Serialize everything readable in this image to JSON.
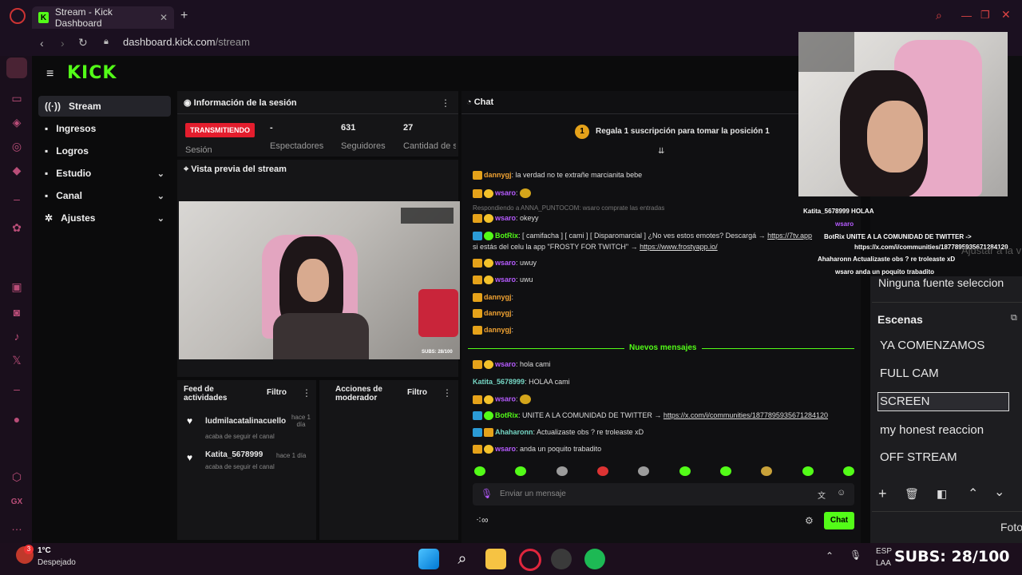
{
  "browser": {
    "tab_title": "Stream - Kick Dashboard",
    "new_tab": "+",
    "url_host": "dashboard.kick.com",
    "url_path": "/stream"
  },
  "dashboard": {
    "logo": "KICK",
    "nav": [
      {
        "label": "Stream",
        "icon": "broadcast-icon"
      },
      {
        "label": "Ingresos",
        "icon": "money-icon"
      },
      {
        "label": "Logros",
        "icon": "trophy-icon"
      },
      {
        "label": "Estudio",
        "icon": "studio-icon"
      },
      {
        "label": "Canal",
        "icon": "channel-icon"
      },
      {
        "label": "Ajustes",
        "icon": "gear-icon"
      }
    ],
    "session": {
      "title": "Información de la sesión",
      "status_pill": "TRANSMITIENDO",
      "status_label": "Sesión",
      "viewers_value": "-",
      "viewers_label": "Espectadores",
      "followers_value": "631",
      "followers_label": "Seguidores",
      "subs_value": "27",
      "subs_label": "Cantidad de suscripciones"
    },
    "preview": {
      "title": "Vista previa del stream",
      "overlay_subs": "SUBS: 28/100"
    },
    "activity": {
      "title": "Feed de actividades",
      "filter": "Filtro",
      "items": [
        {
          "user": "ludmilacatalinacuello",
          "action": "acaba de seguir el canal",
          "time": "hace 1 día"
        },
        {
          "user": "Katita_5678999",
          "action": "acaba de seguir el canal",
          "time": "hace 1 día"
        }
      ]
    },
    "mod": {
      "title": "Acciones de moderador",
      "filter": "Filtro"
    },
    "chat": {
      "title": "Chat",
      "pinned_badge": "1",
      "pinned_text": "Regala 1 suscripción para tomar la posición 1",
      "reply_note": "Respondiendo a ANNA_PUNTOCOM: wsaro comprate las entradas",
      "new_messages": "Nuevos mensajes",
      "messages_top": [
        {
          "user": "dannygj",
          "text": ": la verdad no te extrañe marcianita bebe"
        },
        {
          "user": "wsaro",
          "text": ":"
        },
        {
          "user": "wsaro",
          "text": ": okeyy"
        },
        {
          "user": "BotRix",
          "text": ": [ camifacha ] [ cami ] [ Disparomarcial ] ¿No ves estos emotes? Descargá → "
        },
        {
          "user": "",
          "text": "si estás del celu la app \"FROSTY FOR TWITCH\" → "
        },
        {
          "user": "wsaro",
          "text": ": uwuy"
        },
        {
          "user": "wsaro",
          "text": ": uwu"
        },
        {
          "user": "dannygj",
          "text": ":"
        },
        {
          "user": "dannygj",
          "text": ":"
        },
        {
          "user": "dannygj",
          "text": ":"
        }
      ],
      "botrix_link1": "https://7tv.app",
      "frosty_link": "https://www.frostyapp.io/",
      "messages_new": [
        {
          "user": "wsaro",
          "text": ": hola cami"
        },
        {
          "user": "Katita_5678999",
          "text": ": HOLAA cami"
        },
        {
          "user": "wsaro",
          "text": ":"
        },
        {
          "user": "BotRix",
          "text": ": UNITE A LA COMUNIDAD DE TWITTER → "
        },
        {
          "user": "Ahaharonn",
          "text": ": Actualizaste obs ? re troleaste xD"
        },
        {
          "user": "wsaro",
          "text": ": anda un poquito trabadito"
        }
      ],
      "twitter_link": "https://x.com/i/communities/1877895935671284120",
      "input_placeholder": "Enviar un mensaje",
      "send_button": "Chat"
    }
  },
  "overlay_chat": {
    "lines": [
      "Katita_5678999 HOLAA",
      "wsaro",
      "BotRix UNITE A LA COMUNIDAD DE TWITTER ->",
      "https://x.com/i/communities/1877895935671284120",
      "Ahaharonn Actualizaste obs ? re troleaste xD",
      "wsaro anda un poquito trabadito"
    ]
  },
  "obs": {
    "source_text": "Ninguna fuente seleccion",
    "scenes_title": "Escenas",
    "scenes": [
      "YA COMENZAMOS",
      "FULL CAM",
      "SCREEN",
      "my honest reaccion",
      "OFF STREAM"
    ],
    "selected_scene": "SCREEN",
    "bottom_text": "Foto",
    "adjust_text": "Ajustar a la v"
  },
  "taskbar": {
    "temp": "1°C",
    "weather": "Despejado",
    "weather_badge": "3",
    "lang": "ESP",
    "lang2": "LAA",
    "subs_overlay": "SUBS: 28/100"
  }
}
